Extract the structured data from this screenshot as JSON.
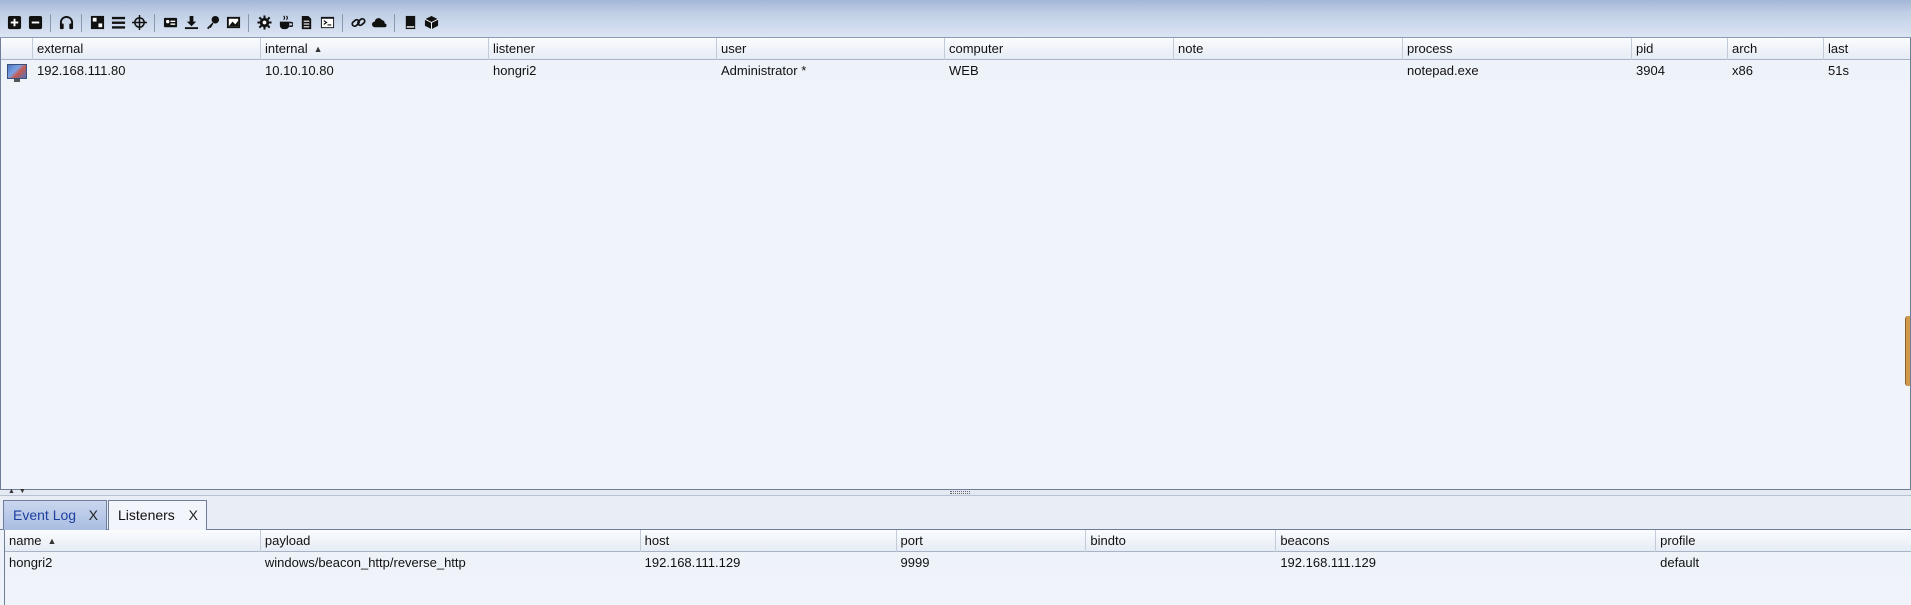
{
  "toolbar": {
    "icons": [
      "new-connection-icon",
      "disconnect-icon",
      "headphones-icon",
      "pivot-graph-icon",
      "session-list-icon",
      "targets-icon",
      "credentials-icon",
      "downloads-icon",
      "keystrokes-icon",
      "screenshots-icon",
      "settings-icon",
      "java-icon",
      "script-console-icon",
      "terminal-icon",
      "link-icon",
      "cloud-icon",
      "book-icon",
      "cube-icon"
    ]
  },
  "sessions": {
    "columns": [
      "external",
      "internal",
      "listener",
      "user",
      "computer",
      "note",
      "process",
      "pid",
      "arch",
      "last"
    ],
    "sorted_column": "internal",
    "rows": [
      {
        "external": "192.168.111.80",
        "internal": "10.10.10.80",
        "listener": "hongri2",
        "user": "Administrator *",
        "computer": "WEB",
        "note": "",
        "process": "notepad.exe",
        "pid": "3904",
        "arch": "x86",
        "last": "51s"
      }
    ]
  },
  "tabs": [
    {
      "label": "Event Log",
      "close": "X",
      "active": false
    },
    {
      "label": "Listeners",
      "close": "X",
      "active": true
    }
  ],
  "listeners": {
    "columns": [
      "name",
      "payload",
      "host",
      "port",
      "bindto",
      "beacons",
      "profile"
    ],
    "sorted_column": "name",
    "rows": [
      {
        "name": "hongri2",
        "payload": "windows/beacon_http/reverse_http",
        "host": "192.168.111.129",
        "port": "9999",
        "bindto": "",
        "beacons": "192.168.111.129",
        "profile": "default"
      }
    ]
  }
}
